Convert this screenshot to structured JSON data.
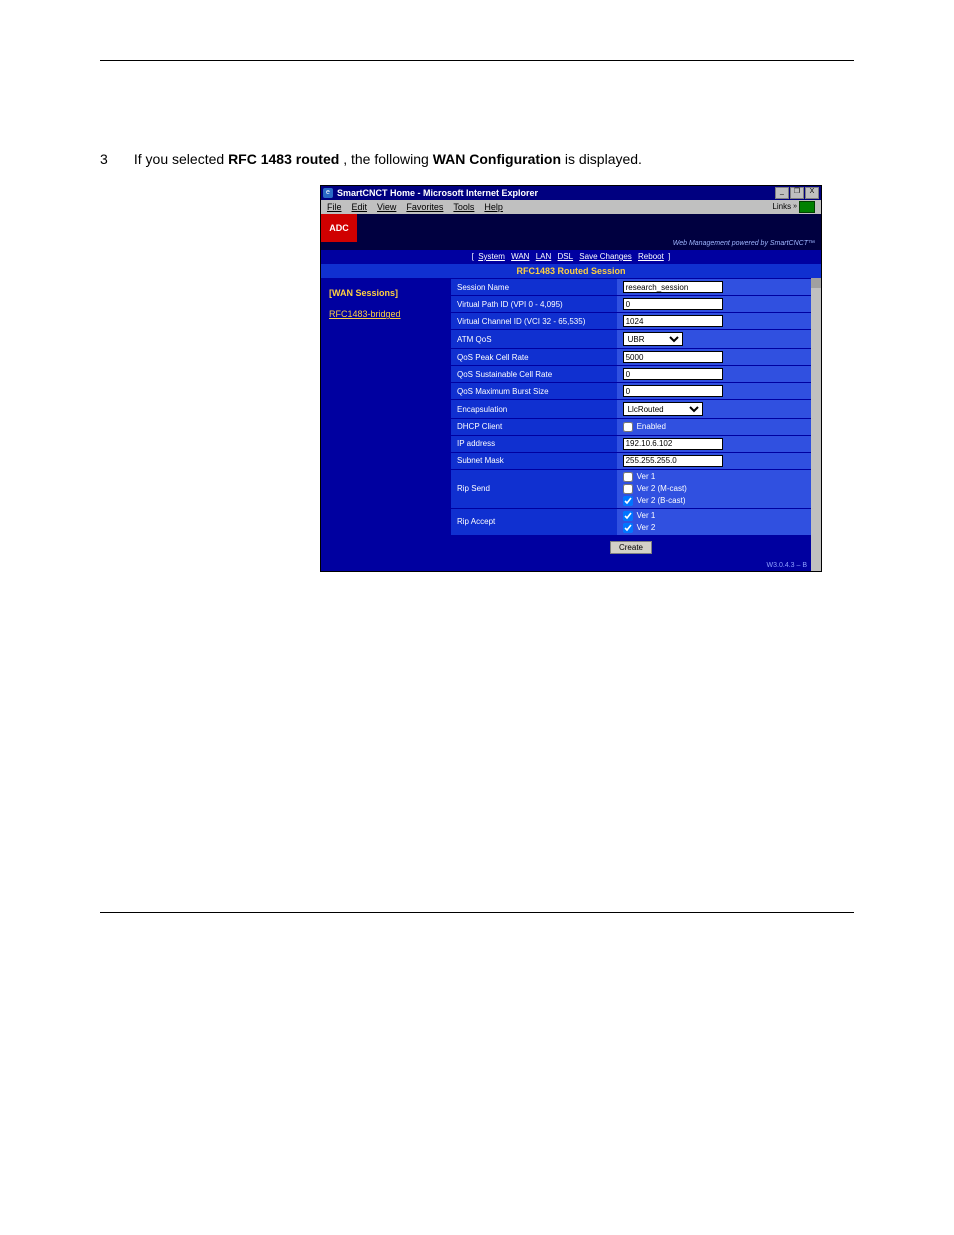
{
  "caption": {
    "step": "3",
    "pre": "If you selected ",
    "bold1": "RFC 1483 routed",
    "mid": ", the following ",
    "bold2": "WAN Configuration",
    "post": " is displayed."
  },
  "window": {
    "title": "SmartCNCT Home - Microsoft Internet Explorer",
    "menu": {
      "file": "File",
      "edit": "Edit",
      "view": "View",
      "favorites": "Favorites",
      "tools": "Tools",
      "help": "Help",
      "links": "Links",
      "go": ""
    },
    "btns": {
      "min": "_",
      "max": "❐",
      "close": "X"
    },
    "logo": "ADC",
    "powered": "Web Management powered by SmartCNCT™",
    "tabs": {
      "bl": "[",
      "system": "System",
      "wan": "WAN",
      "lan": "LAN",
      "dsl": "DSL",
      "save": "Save Changes",
      "reboot": "Reboot",
      "br": "]"
    },
    "section_title": "RFC1483 Routed Session",
    "sidebar": {
      "sessions_head": "[WAN Sessions]",
      "session_item": "RFC1483-bridged"
    },
    "form": {
      "session_name": {
        "label": "Session Name",
        "value": "research_session"
      },
      "vpi": {
        "label": "Virtual Path ID (VPI 0 - 4,095)",
        "value": "0"
      },
      "vci": {
        "label": "Virtual Channel ID (VCI 32 - 65,535)",
        "value": "1024"
      },
      "atmqos": {
        "label": "ATM QoS",
        "value": "UBR"
      },
      "peak": {
        "label": "QoS Peak Cell Rate",
        "value": "5000"
      },
      "sustain": {
        "label": "QoS Sustainable Cell Rate",
        "value": "0"
      },
      "maxburst": {
        "label": "QoS Maximum Burst Size",
        "value": "0"
      },
      "encap": {
        "label": "Encapsulation",
        "value": "LlcRouted"
      },
      "dhcp": {
        "label": "DHCP Client",
        "enabled_label": "Enabled",
        "checked": false
      },
      "ipaddr": {
        "label": "IP address",
        "value": "192.10.6.102"
      },
      "subnet": {
        "label": "Subnet Mask",
        "value": "255.255.255.0"
      },
      "ripsend": {
        "label": "Rip Send",
        "v1": {
          "label": "Ver 1",
          "checked": false
        },
        "v2m": {
          "label": "Ver 2 (M-cast)",
          "checked": false
        },
        "v2b": {
          "label": "Ver 2 (B-cast)",
          "checked": true
        }
      },
      "ripaccept": {
        "label": "Rip Accept",
        "v1": {
          "label": "Ver 1",
          "checked": true
        },
        "v2": {
          "label": "Ver 2",
          "checked": true
        }
      },
      "create": "Create"
    },
    "footer_tag": "W3.0.4.3 – B"
  }
}
